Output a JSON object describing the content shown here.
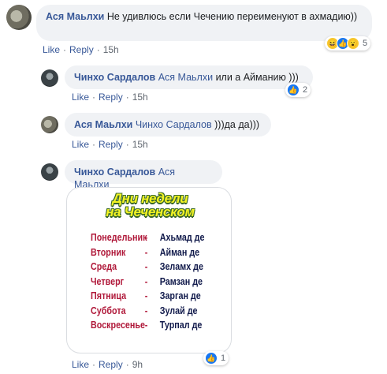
{
  "comments": [
    {
      "author": "Ася Маьлхи",
      "mention": "",
      "text": "Не удивлюсь если Чечению переименуют в ахмадию))",
      "like_label": "Like",
      "reply_label": "Reply",
      "time": "15h",
      "reactions": {
        "icons": [
          "haha-icon",
          "like-icon",
          "wow-icon"
        ],
        "count": "5"
      }
    },
    {
      "author": "Чинхо Сардалов",
      "mention": "Ася Маьлхи",
      "text": "или а Айманию )))",
      "like_label": "Like",
      "reply_label": "Reply",
      "time": "15h",
      "reactions": {
        "icons": [
          "like-icon"
        ],
        "count": "2"
      }
    },
    {
      "author": "Ася Маьлхи",
      "mention": "Чинхо Сардалов",
      "text": ")))да да)))",
      "like_label": "Like",
      "reply_label": "Reply",
      "time": "15h"
    },
    {
      "author": "Чинхо Сардалов",
      "mention": "Ася Маьлхи",
      "text": "",
      "like_label": "Like",
      "reply_label": "Reply",
      "time": "9h",
      "reactions": {
        "icons": [
          "like-icon"
        ],
        "count": "1"
      }
    }
  ],
  "image": {
    "title_line1": "Дни недели",
    "title_line2": "на Чеченском",
    "days": [
      {
        "day": "Понедельник",
        "dash": "-",
        "name": "Ахьмад де"
      },
      {
        "day": "Вторник",
        "dash": "-",
        "name": "Айман де"
      },
      {
        "day": "Среда",
        "dash": "-",
        "name": "Зеламх де"
      },
      {
        "day": "Четверг",
        "dash": "-",
        "name": "Рамзан де"
      },
      {
        "day": "Пятница",
        "dash": "-",
        "name": "Зарган де"
      },
      {
        "day": "Суббота",
        "dash": "-",
        "name": "Зулай де"
      },
      {
        "day": "Воскресенье",
        "dash": "-",
        "name": "Турпал де"
      }
    ],
    "colors": {
      "title": "#f3f323",
      "title_outline": "#3d6b2a",
      "day": "#b0193a",
      "name": "#111a4b"
    }
  },
  "colors": {
    "link": "#385898",
    "bubble": "#f0f2f5",
    "meta": "#606770",
    "like": "#1877f2"
  }
}
